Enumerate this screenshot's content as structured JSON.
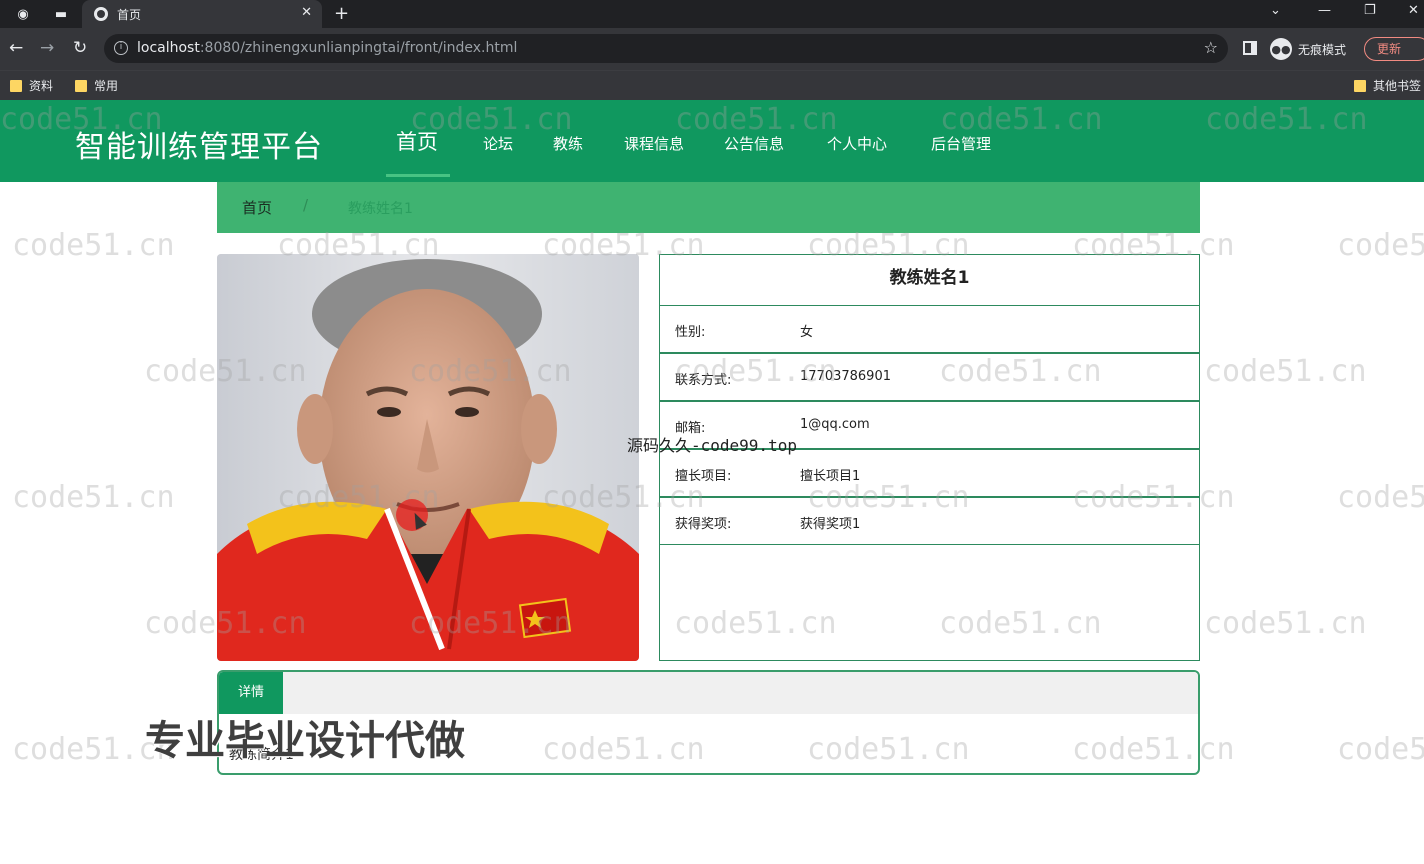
{
  "browser": {
    "tab_title": "首页",
    "url_host": "localhost",
    "url_rest": ":8080/zhinengxunlianpingtai/front/index.html",
    "incognito_label": "无痕模式",
    "update_label": "更新",
    "bookmarks": [
      "资料",
      "常用"
    ],
    "other_bookmarks": "其他书签"
  },
  "site": {
    "title": "智能训练管理平台",
    "nav": [
      "首页",
      "论坛",
      "教练",
      "课程信息",
      "公告信息",
      "个人中心",
      "后台管理"
    ]
  },
  "breadcrumb": {
    "home": "首页",
    "separator": "/",
    "current": "教练姓名1"
  },
  "coach": {
    "name": "教练姓名1",
    "fields": [
      {
        "label": "性别:",
        "value": "女"
      },
      {
        "label": "联系方式:",
        "value": "17703786901"
      },
      {
        "label": "邮箱:",
        "value": "1@qq.com"
      },
      {
        "label": "擅长项目:",
        "value": "擅长项目1"
      },
      {
        "label": "获得奖项:",
        "value": "获得奖项1"
      }
    ]
  },
  "detail": {
    "tab_label": "详情",
    "content": "教练简介1"
  },
  "overlays": {
    "watermark": "code51.cn",
    "source_text": "源码久久-code99.top",
    "ad_text": "专业毕业设计代做"
  },
  "colors": {
    "header_green": "#10985f",
    "breadcrumb_green": "#3fb371",
    "border_green": "#2d8a5e"
  }
}
